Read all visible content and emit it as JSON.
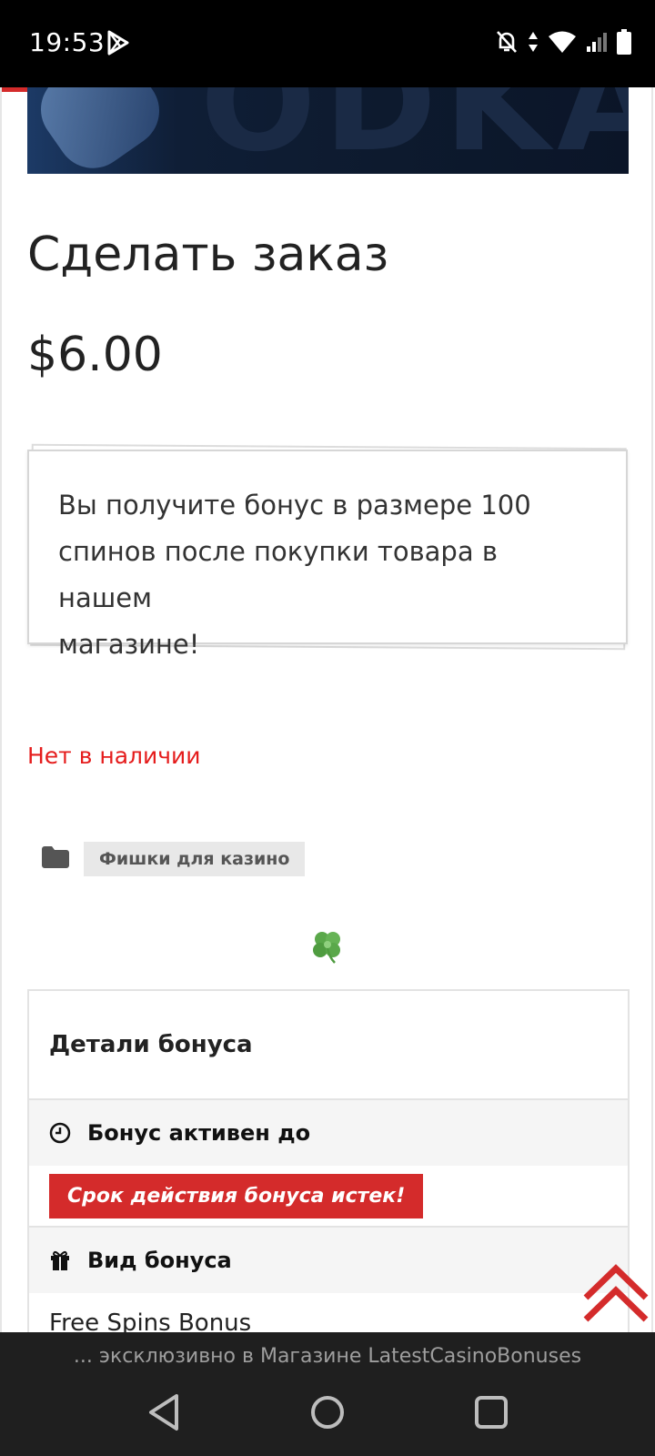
{
  "status_bar": {
    "time": "19:53",
    "icons": [
      "play-store-icon",
      "bell-off-icon",
      "data-arrows-icon",
      "wifi-icon",
      "cell-signal-icon",
      "battery-icon"
    ]
  },
  "product": {
    "title": "Сделать заказ",
    "price": "$6.00",
    "note_line1": "Вы получите бонус в размере 100",
    "note_line2": "спинов после покупки товара в нашем",
    "note_line3": "магазине!",
    "stock_status": "Нет в наличии",
    "category": "Фишки для казино"
  },
  "bonus": {
    "heading": "Детали бонуса",
    "active_until_label": "Бонус активен до",
    "expired_text": "Срок действия бонуса истек!",
    "type_label": "Вид бонуса",
    "type_value": "Free Spins Bonus"
  },
  "banner": {
    "text": "... эксклюзивно в Магазине LatestCasinoBonuses"
  },
  "colors": {
    "accent_red": "#d42b2b",
    "stock_red": "#e51c1c",
    "nav_bg": "#1f1f1f"
  }
}
